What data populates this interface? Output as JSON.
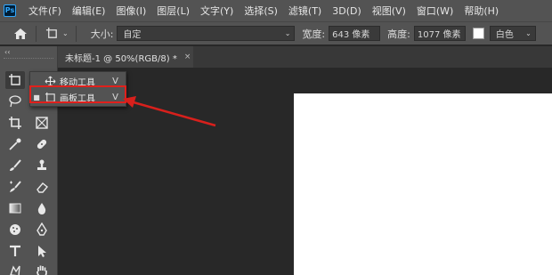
{
  "app": {
    "logo_text": "Ps"
  },
  "menu": [
    "文件(F)",
    "编辑(E)",
    "图像(I)",
    "图层(L)",
    "文字(Y)",
    "选择(S)",
    "滤镜(T)",
    "3D(D)",
    "视图(V)",
    "窗口(W)",
    "帮助(H)"
  ],
  "options": {
    "size_label": "大小:",
    "size_value": "自定",
    "width_label": "宽度:",
    "width_value": "643 像素",
    "height_label": "高度:",
    "height_value": "1077 像素",
    "background_value": "白色"
  },
  "tab": {
    "title": "未标题-1 @ 50%(RGB/8) *",
    "close": "×"
  },
  "toolbar": {
    "collapse": "‹‹"
  },
  "flyout": {
    "items": [
      {
        "label": "移动工具",
        "shortcut": "V",
        "icon": "move-icon",
        "active": false
      },
      {
        "label": "画板工具",
        "shortcut": "V",
        "icon": "artboard-icon",
        "active": true
      }
    ]
  },
  "colors": {
    "highlight": "#e0201c",
    "arrow": "#d8201c",
    "panel": "#535353",
    "canvas": "#282828"
  }
}
